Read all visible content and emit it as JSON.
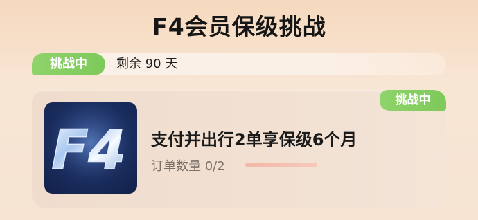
{
  "header": {
    "title": "F4会员保级挑战"
  },
  "status_bar": {
    "badge": "挑战中",
    "remaining": "剩余 90 天"
  },
  "task_card": {
    "badge": "挑战中",
    "logo_text": "F4",
    "title": "支付并出行2单享保级6个月",
    "progress_label": "订单数量 0/2",
    "progress": 0
  },
  "colors": {
    "accent_green": "#8fd36b",
    "logo_background": "#1a2d5e",
    "progress_track": "#f3b7a6"
  }
}
